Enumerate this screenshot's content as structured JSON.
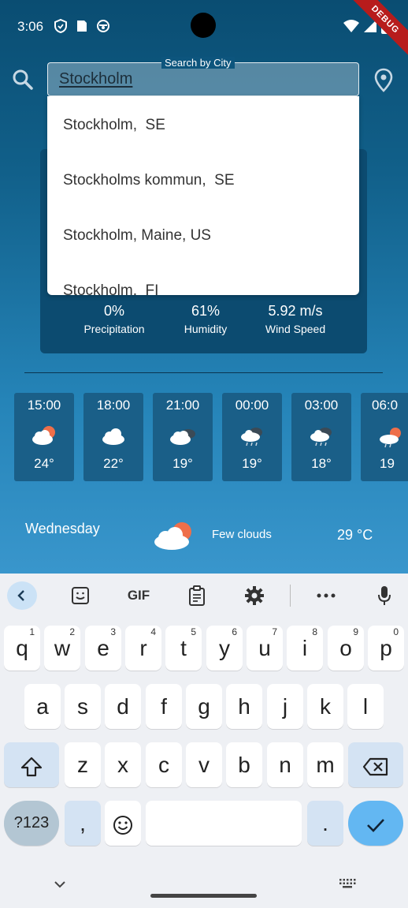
{
  "status_bar": {
    "time": "3:06",
    "debug_label": "DEBUG"
  },
  "search": {
    "label": "Search by City",
    "value": "Stockholm"
  },
  "suggestions": [
    "Stockholm,  SE",
    "Stockholms kommun,  SE",
    "Stockholm, Maine, US",
    "Stockholm,  FI"
  ],
  "current": {
    "precipitation": {
      "value": "0%",
      "label": "Precipitation"
    },
    "humidity": {
      "value": "61%",
      "label": "Humidity"
    },
    "wind": {
      "value": "5.92 m/s",
      "label": "Wind Speed"
    }
  },
  "hourly": [
    {
      "time": "15:00",
      "temp": "24°",
      "icon": "sun-cloud-icon"
    },
    {
      "time": "18:00",
      "temp": "22°",
      "icon": "cloud-icon"
    },
    {
      "time": "21:00",
      "temp": "19°",
      "icon": "dark-cloud-icon"
    },
    {
      "time": "00:00",
      "temp": "19°",
      "icon": "rain-cloud-icon"
    },
    {
      "time": "03:00",
      "temp": "18°",
      "icon": "rain-cloud-icon"
    },
    {
      "time": "06:0",
      "temp": "19",
      "icon": "sun-cloud-icon"
    }
  ],
  "daily": {
    "day": "Wednesday",
    "description": "Few clouds",
    "temp": "29 °C"
  },
  "keyboard": {
    "toolbar": {
      "gif": "GIF"
    },
    "row1": [
      {
        "k": "q",
        "h": "1"
      },
      {
        "k": "w",
        "h": "2"
      },
      {
        "k": "e",
        "h": "3"
      },
      {
        "k": "r",
        "h": "4"
      },
      {
        "k": "t",
        "h": "5"
      },
      {
        "k": "y",
        "h": "6"
      },
      {
        "k": "u",
        "h": "7"
      },
      {
        "k": "i",
        "h": "8"
      },
      {
        "k": "o",
        "h": "9"
      },
      {
        "k": "p",
        "h": "0"
      }
    ],
    "row2": [
      "a",
      "s",
      "d",
      "f",
      "g",
      "h",
      "j",
      "k",
      "l"
    ],
    "row3": [
      "z",
      "x",
      "c",
      "v",
      "b",
      "n",
      "m"
    ],
    "symbols": "?123",
    "comma": ",",
    "period": "."
  },
  "colors": {
    "accent": "#3f9fde",
    "card": "#0c4b70"
  }
}
